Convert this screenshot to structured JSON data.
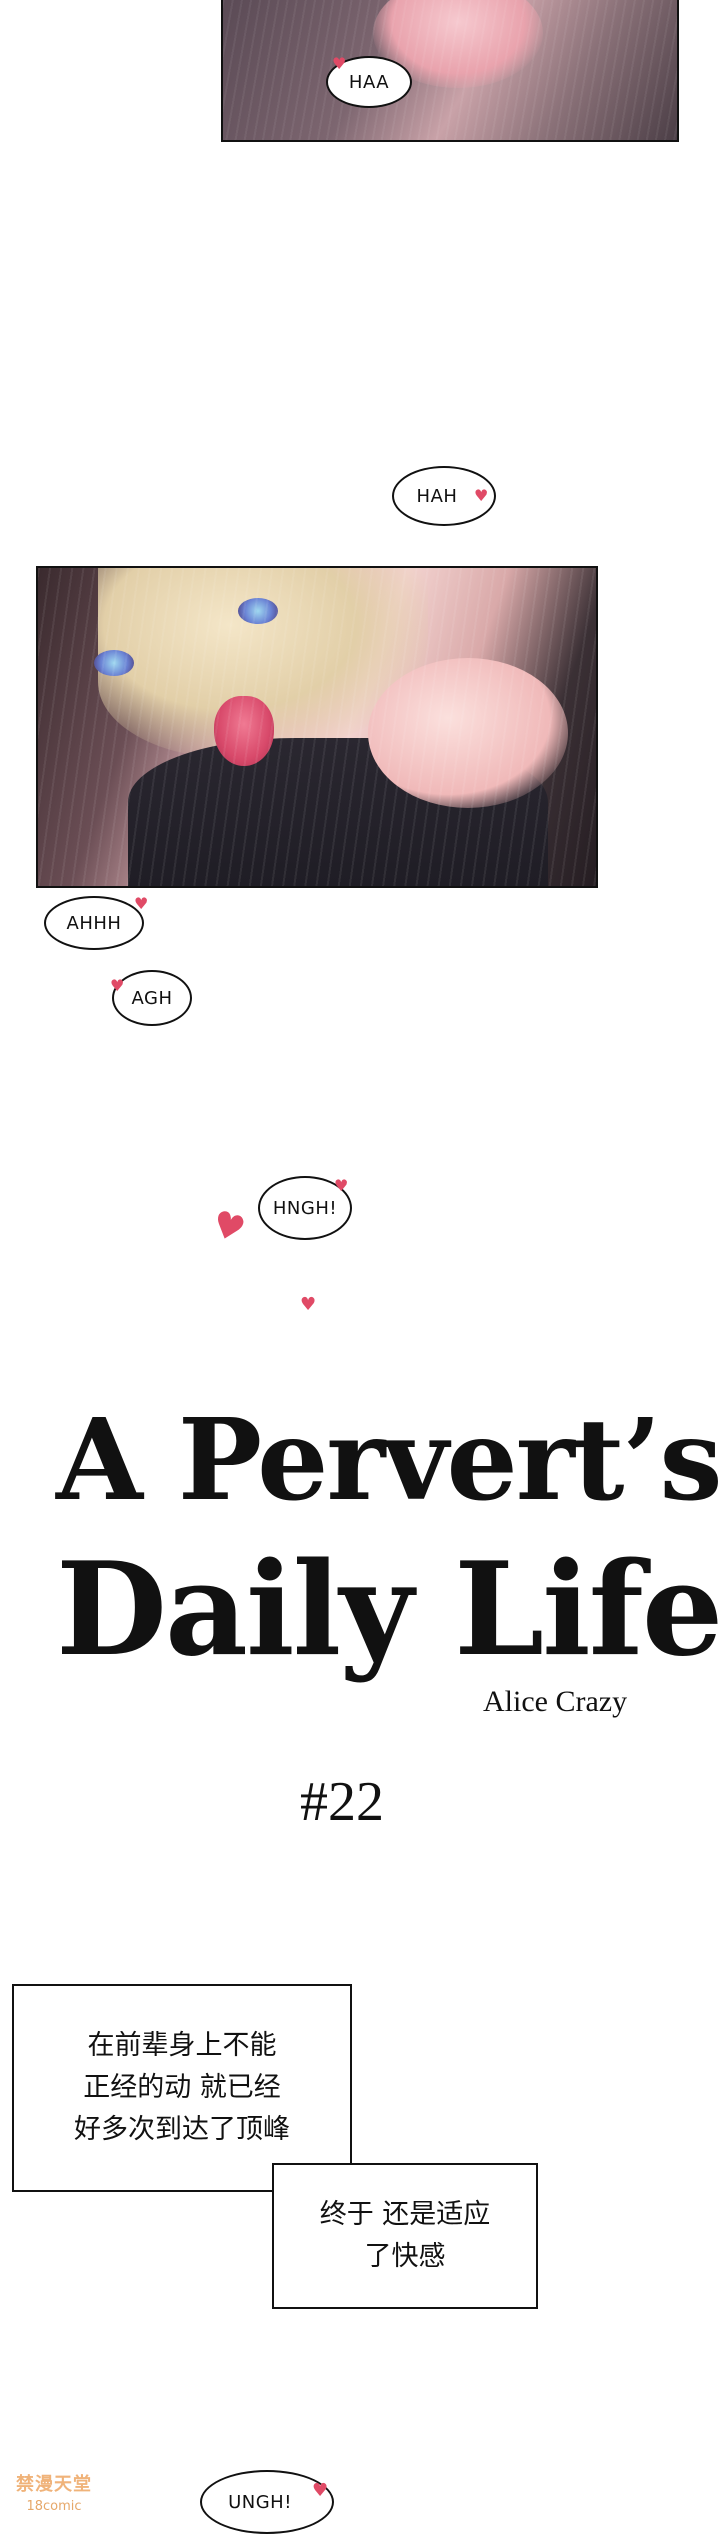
{
  "bubbles": {
    "haa": "HAA",
    "hah": "HAH",
    "ahhh": "AHHH",
    "agh": "AGH",
    "hngh": "HNGH!",
    "ungh": "UNGH!"
  },
  "title": {
    "line1": "A Pervert’s",
    "line2": "Daily Life",
    "author": "Alice Crazy"
  },
  "chapter": "#22",
  "narration": {
    "box1": "在前辈身上不能\n正经的动 就已经\n好多次到达了顶峰",
    "box2": "终于 还是适应\n了快感"
  },
  "watermark": {
    "line1": "禁漫天堂",
    "line2": "18comic"
  },
  "icons": {
    "heart": "heart-icon"
  },
  "colors": {
    "heart": "#e04a66",
    "watermark": "#e6a86a"
  }
}
